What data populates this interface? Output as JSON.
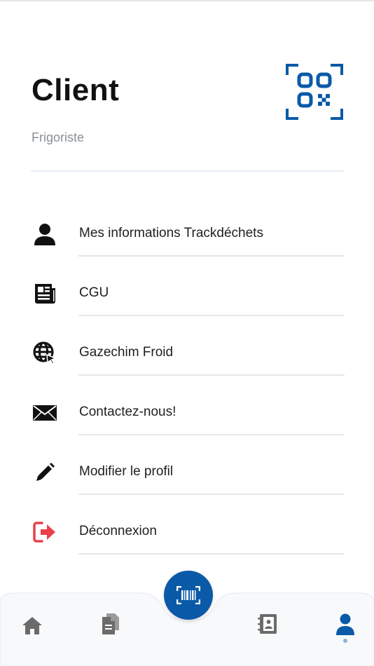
{
  "profile": {
    "title": "Client",
    "subtitle": "Frigoriste"
  },
  "header": {
    "qr_icon": "qr-code-scan-icon"
  },
  "menu": {
    "items": [
      {
        "label": "Mes informations Trackdéchets",
        "icon": "user-icon"
      },
      {
        "label": "CGU",
        "icon": "newspaper-icon"
      },
      {
        "label": "Gazechim Froid",
        "icon": "globe-icon"
      },
      {
        "label": "Contactez-nous!",
        "icon": "envelope-icon"
      },
      {
        "label": "Modifier le profil",
        "icon": "pencil-icon"
      },
      {
        "label": "Déconnexion",
        "icon": "logout-icon"
      }
    ]
  },
  "bottom_nav": {
    "items": [
      {
        "icon": "home-icon",
        "active": false
      },
      {
        "icon": "documents-icon",
        "active": false
      },
      {
        "icon": "barcode-scan-icon",
        "active": false
      },
      {
        "icon": "contacts-book-icon",
        "active": false
      },
      {
        "icon": "profile-icon",
        "active": true
      }
    ]
  },
  "colors": {
    "primary": "#0a5aa8",
    "logout": "#e8404a",
    "inactive_nav": "#6b6b6b",
    "active_nav": "#0a5aa8"
  }
}
